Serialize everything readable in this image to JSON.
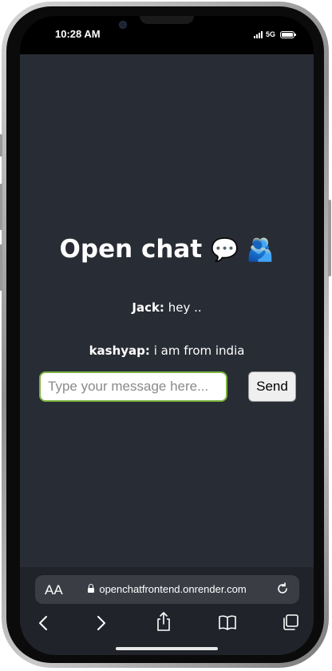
{
  "status_bar": {
    "time": "10:28 AM",
    "network": "5G"
  },
  "chat": {
    "title": "Open chat",
    "title_emojis": "💬 🫂",
    "messages": [
      {
        "user": "Jack:",
        "text": "hey .."
      },
      {
        "user": "kashyap:",
        "text": "i am from india"
      }
    ],
    "input_placeholder": "Type your message here...",
    "input_value": "",
    "send_label": "Send"
  },
  "browser": {
    "text_size_label": "AA",
    "url": "openchatfrontend.onrender.com",
    "icons": [
      "text-size-icon",
      "lock-icon",
      "reload-icon",
      "back-icon",
      "forward-icon",
      "share-icon",
      "bookmarks-icon",
      "tabs-icon"
    ]
  },
  "colors": {
    "page_background": "#282c34",
    "input_border": "#7cb342",
    "browser_bar": "#202329"
  }
}
